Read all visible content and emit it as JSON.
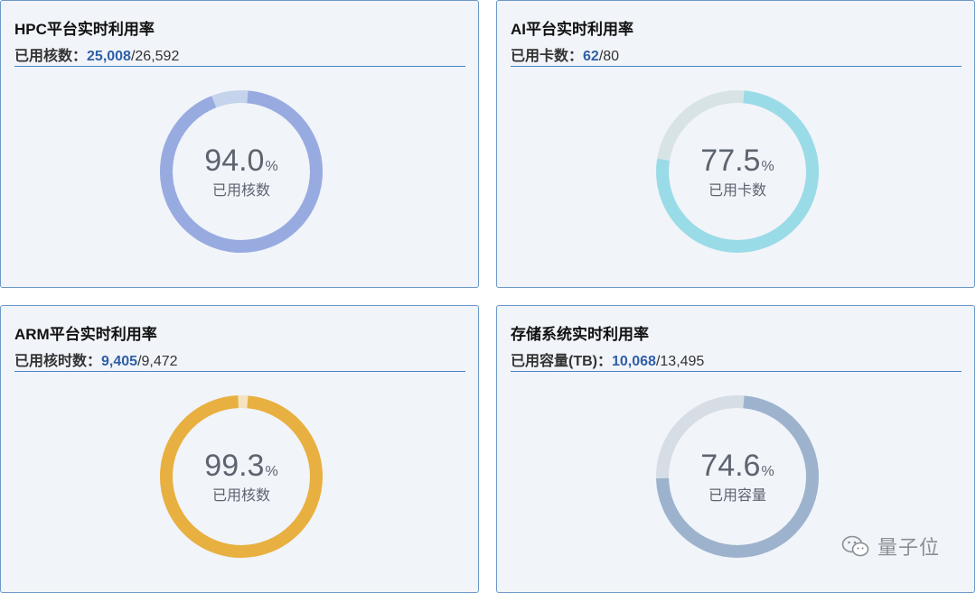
{
  "panels": [
    {
      "title": "HPC平台实时利用率",
      "sub_label": "已用核数：",
      "used": "25,008",
      "sep": "/",
      "total": "26,592",
      "percent": "94.0",
      "unit": "%",
      "center_label": "已用核数",
      "fraction": 0.94,
      "color_used": "#98abe1",
      "color_track": "#c5d3ec"
    },
    {
      "title": "AI平台实时利用率",
      "sub_label": "已用卡数：",
      "used": "62",
      "sep": "/",
      "total": "80",
      "percent": "77.5",
      "unit": "%",
      "center_label": "已用卡数",
      "fraction": 0.775,
      "color_used": "#9adbe8",
      "color_track": "#d8e3e6"
    },
    {
      "title": "ARM平台实时利用率",
      "sub_label": "已用核时数：",
      "used": "9,405",
      "sep": "/",
      "total": "9,472",
      "percent": "99.3",
      "unit": "%",
      "center_label": "已用核数",
      "fraction": 0.993,
      "color_used": "#e8b040",
      "color_track": "#f3e3c0"
    },
    {
      "title": "存储系统实时利用率",
      "sub_label": "已用容量(TB)：",
      "used": "10,068",
      "sep": "/",
      "total": "13,495",
      "percent": "74.6",
      "unit": "%",
      "center_label": "已用容量",
      "fraction": 0.746,
      "color_used": "#9db3cd",
      "color_track": "#d6dde4"
    }
  ],
  "watermark": {
    "text": "量子位",
    "icon": "wechat-icon"
  }
}
